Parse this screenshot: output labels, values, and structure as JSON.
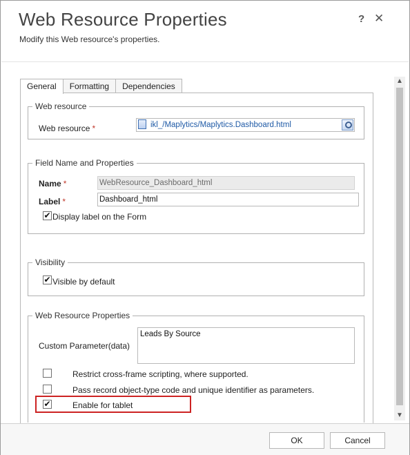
{
  "dialog": {
    "title": "Web Resource Properties",
    "subtitle": "Modify this Web resource's properties.",
    "help_glyph": "?",
    "close_glyph": "✕"
  },
  "tabs": [
    {
      "label": "General",
      "active": true
    },
    {
      "label": "Formatting",
      "active": false
    },
    {
      "label": "Dependencies",
      "active": false
    }
  ],
  "web_resource_section": {
    "legend": "Web resource",
    "field_label": "Web resource",
    "required_mark": "*",
    "value": "ikl_/Maplytics/Maplytics.Dashboard.html"
  },
  "field_name_section": {
    "legend": "Field Name and Properties",
    "name_label": "Name",
    "name_required_mark": "*",
    "name_value": "WebResource_Dashboard_html",
    "label_label": "Label",
    "label_required_mark": "*",
    "label_value": "Dashboard_html",
    "display_label_checkbox": "Display label on the Form",
    "display_label_checked": true
  },
  "visibility_section": {
    "legend": "Visibility",
    "visible_checkbox": "Visible by default",
    "visible_checked": true
  },
  "wr_props_section": {
    "legend": "Web Resource Properties",
    "custom_param_label": "Custom Parameter(data)",
    "custom_param_value": "Leads By Source",
    "restrict_label": "Restrict cross-frame scripting, where supported.",
    "restrict_checked": false,
    "pass_record_label": "Pass record object-type code and unique identifier as parameters.",
    "pass_record_checked": false,
    "tablet_label": "Enable for tablet",
    "tablet_checked": true,
    "highlight_color": "#cc2222"
  },
  "footer": {
    "ok_label": "OK",
    "cancel_label": "Cancel"
  },
  "glyphs": {
    "checkmark": "✔",
    "scroll_up": "▲",
    "scroll_down": "▼"
  }
}
